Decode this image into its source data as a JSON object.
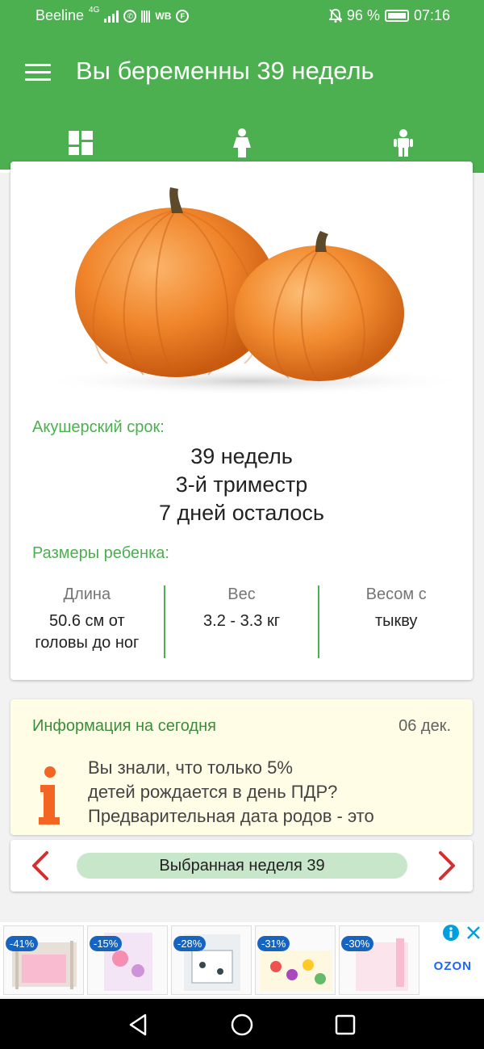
{
  "status_bar": {
    "carrier": "Beeline",
    "network": "4G",
    "wb": "WB",
    "battery": "96 %",
    "time": "07:16"
  },
  "app_bar": {
    "title": "Вы беременны 39 недель",
    "tabs": [
      "dashboard",
      "mother",
      "baby"
    ],
    "active_tab": 0
  },
  "main_card": {
    "obstetric_label": "Акушерский срок:",
    "weeks": "39 недель",
    "trimester": "3-й триместр",
    "days_left": "7 дней осталось",
    "sizes_label": "Размеры ребенка:",
    "sizes": [
      {
        "header": "Длина",
        "value_line1": "50.6 см от",
        "value_line2": "головы до ног"
      },
      {
        "header": "Вес",
        "value_line1": "3.2 - 3.3 кг",
        "value_line2": ""
      },
      {
        "header": "Весом с",
        "value_line1": "тыкву",
        "value_line2": ""
      }
    ]
  },
  "info_card": {
    "title": "Информация на сегодня",
    "date": "06 дек.",
    "line1": "Вы знали, что только 5%",
    "line2": "детей рождается в день ПДР?",
    "line3": "Предварительная дата родов - это"
  },
  "week_selector": {
    "label": "Выбранная неделя 39"
  },
  "ads": {
    "badges": [
      "-41%",
      "-15%",
      "-28%",
      "-31%",
      "-30%"
    ],
    "brand": "OZON"
  },
  "colors": {
    "primary": "#4caf50",
    "accent_green_text": "#4caf50",
    "arrow_red": "#d32f2f",
    "info_bg": "#fffde5",
    "pumpkin": "#f28c28"
  }
}
